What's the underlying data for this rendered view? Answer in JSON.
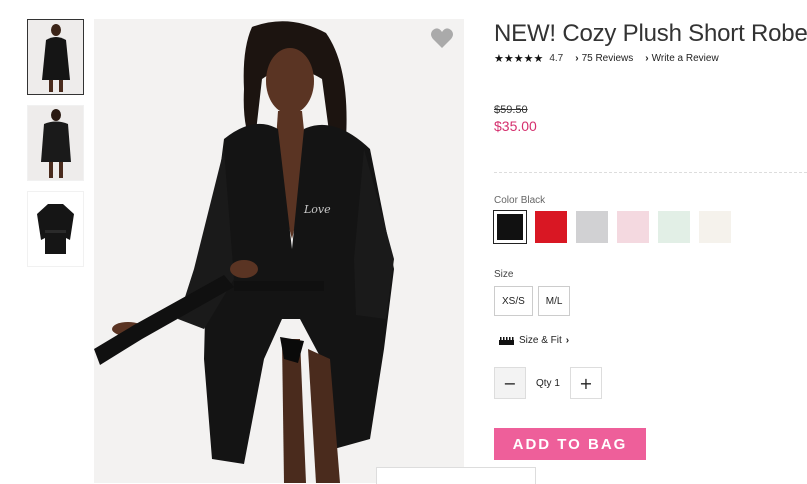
{
  "product": {
    "title": "NEW! Cozy Plush Short Robe",
    "stars": "★★★★★",
    "rating": "4.7",
    "reviews_link": "75 Reviews",
    "write_review_link": "Write a Review",
    "old_price": "$59.50",
    "price": "$35.00",
    "price_color": "#d5306e"
  },
  "gallery": {
    "thumbnails": [
      {
        "id": "front",
        "selected": true
      },
      {
        "id": "back",
        "selected": false
      },
      {
        "id": "flat",
        "selected": false
      }
    ],
    "favorite_icon": "heart-icon"
  },
  "color": {
    "label": "Color",
    "selected_name": "Black",
    "swatches": [
      {
        "name": "Black",
        "hex": "#111111",
        "selected": true
      },
      {
        "name": "Red",
        "hex": "#d91723",
        "selected": false
      },
      {
        "name": "Grey",
        "hex": "#d1d1d3",
        "selected": false
      },
      {
        "name": "Pink",
        "hex": "#f4d9e0",
        "selected": false
      },
      {
        "name": "Mint",
        "hex": "#e2efe6",
        "selected": false
      },
      {
        "name": "Ivory",
        "hex": "#f5f2ec",
        "selected": false
      }
    ]
  },
  "size": {
    "label": "Size",
    "options": [
      "XS/S",
      "M/L"
    ],
    "size_fit_link": "Size & Fit"
  },
  "quantity": {
    "label": "Qty",
    "value": "1",
    "minus": "−",
    "plus": "+"
  },
  "add_to_bag": {
    "label": "ADD TO BAG",
    "color": "#ee5f9a"
  },
  "icons": {
    "chevron": "›",
    "ruler": "ruler-icon"
  }
}
